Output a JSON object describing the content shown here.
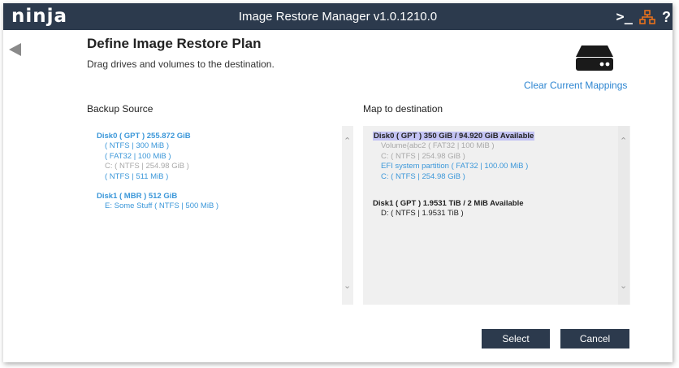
{
  "app": {
    "brand": "ninja",
    "title": "Image Restore Manager v1.0.1210.0",
    "icons": [
      "terminal-icon",
      "network-icon",
      "help-icon"
    ],
    "help_glyph": "?",
    "terminal_glyph": ">_"
  },
  "page": {
    "title": "Define Image Restore Plan",
    "subtitle": "Drag drives and volumes to the destination.",
    "clear_link": "Clear Current Mappings"
  },
  "source": {
    "label": "Backup Source",
    "disks": [
      {
        "label": "Disk0 ( GPT ) 255.872 GiB",
        "volumes": [
          {
            "label": "( NTFS | 300 MiB )",
            "state": "available"
          },
          {
            "label": "( FAT32 | 100 MiB )",
            "state": "available"
          },
          {
            "label": "C: ( NTFS | 254.98 GiB )",
            "state": "mapped"
          },
          {
            "label": "( NTFS | 511 MiB )",
            "state": "available"
          }
        ]
      },
      {
        "label": "Disk1 ( MBR ) 512 GiB",
        "volumes": [
          {
            "label": "E: Some Stuff ( NTFS | 500 MiB )",
            "state": "available"
          }
        ]
      }
    ]
  },
  "destination": {
    "label": "Map to destination",
    "disks": [
      {
        "label": "Disk0 ( GPT ) 350 GiB / 94.920 GiB Available",
        "selected": true,
        "volumes": [
          {
            "label": "Volume{abc2 ( FAT32 | 100 MiB )",
            "state": "existing"
          },
          {
            "label": "C: ( NTFS | 254.98 GiB )",
            "state": "existing"
          },
          {
            "label": "EFI system partition ( FAT32 | 100.00 MiB )",
            "state": "mapped"
          },
          {
            "label": "C: ( NTFS | 254.98 GiB )",
            "state": "mapped"
          }
        ]
      },
      {
        "label": "Disk1 ( GPT ) 1.9531 TiB / 2 MiB Available",
        "selected": false,
        "volumes": [
          {
            "label": "D: ( NTFS | 1.9531 TiB )",
            "state": "plain"
          }
        ]
      }
    ]
  },
  "buttons": {
    "select": "Select",
    "cancel": "Cancel"
  },
  "colors": {
    "titlebar": "#2c3a4d",
    "link_blue": "#2e86d1",
    "volume_blue": "#3b97d9",
    "muted_gray": "#a9a9a9",
    "network_orange": "#e9711c",
    "selection": "#c3c3f4"
  }
}
